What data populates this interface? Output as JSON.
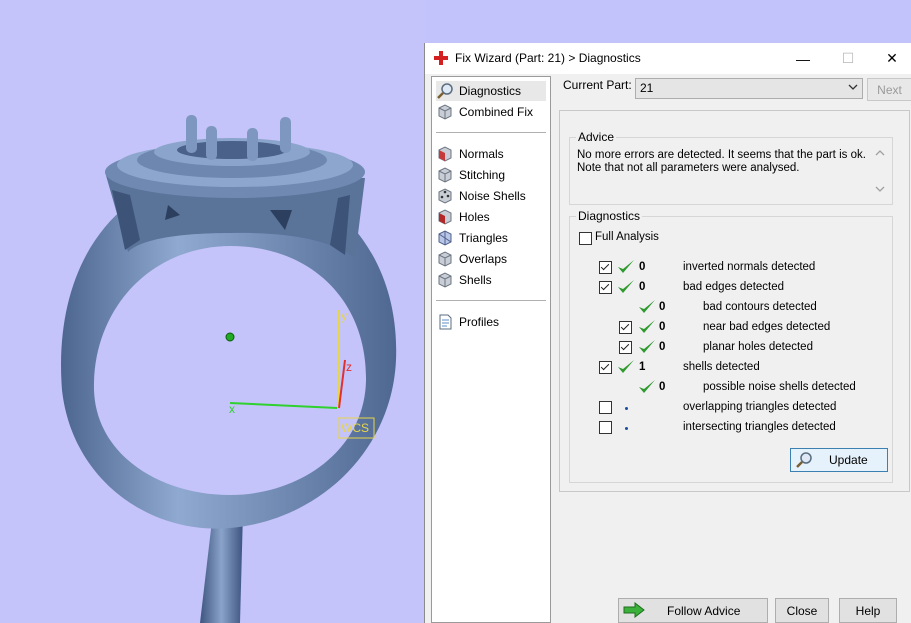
{
  "window": {
    "title": "Fix Wizard (Part: 21) > Diagnostics",
    "minimize_glyph": "—",
    "maximize_glyph": "☐",
    "close_glyph": "✕"
  },
  "nav": {
    "items": [
      {
        "label": "Diagnostics",
        "icon": "magnifier-icon"
      },
      {
        "label": "Combined Fix",
        "icon": "cube-icon"
      },
      {
        "label": "Normals",
        "icon": "cube-red-icon"
      },
      {
        "label": "Stitching",
        "icon": "cube-icon"
      },
      {
        "label": "Noise Shells",
        "icon": "cube-dots-icon"
      },
      {
        "label": "Holes",
        "icon": "cube-red-icon"
      },
      {
        "label": "Triangles",
        "icon": "cube-blue-icon"
      },
      {
        "label": "Overlaps",
        "icon": "cube-icon"
      },
      {
        "label": "Shells",
        "icon": "cube-icon"
      },
      {
        "label": "Profiles",
        "icon": "document-icon"
      }
    ]
  },
  "header": {
    "current_part_label": "Current Part:",
    "current_part_value": "21",
    "next_label": "Next"
  },
  "advice": {
    "group_label": "Advice",
    "line1": "No more errors are detected. It seems that the part is ok.",
    "line2": "Note that not all parameters were analysed."
  },
  "diagnostics": {
    "group_label": "Diagnostics",
    "full_analysis_label": "Full Analysis",
    "full_analysis_checked": false,
    "rows": [
      {
        "checked": true,
        "status": "ok",
        "count": "0",
        "label": "inverted normals detected",
        "indent": 0
      },
      {
        "checked": true,
        "status": "ok",
        "count": "0",
        "label": "bad edges detected",
        "indent": 0
      },
      {
        "checked": null,
        "status": "ok",
        "count": "0",
        "label": "bad contours detected",
        "indent": 2
      },
      {
        "checked": true,
        "status": "ok",
        "count": "0",
        "label": "near bad edges detected",
        "indent": 1
      },
      {
        "checked": true,
        "status": "ok",
        "count": "0",
        "label": "planar holes detected",
        "indent": 1
      },
      {
        "checked": true,
        "status": "ok",
        "count": "1",
        "label": "shells detected",
        "indent": 0
      },
      {
        "checked": null,
        "status": "ok",
        "count": "0",
        "label": "possible noise shells detected",
        "indent": 2
      },
      {
        "checked": false,
        "status": "none",
        "count": "",
        "label": "overlapping triangles detected",
        "indent": 0
      },
      {
        "checked": false,
        "status": "none",
        "count": "",
        "label": "intersecting triangles detected",
        "indent": 0
      }
    ],
    "update_label": "Update"
  },
  "footer": {
    "follow_advice_label": "Follow Advice",
    "close_label": "Close",
    "help_label": "Help"
  },
  "viewport": {
    "axis_x": "x",
    "axis_y": "y",
    "axis_z": "z",
    "wcs_label": "WCS"
  },
  "colors": {
    "viewport_bg": "#c4c3fa",
    "ring": "#7f9ac2",
    "check_green": "#2e9a2e",
    "axis_x": "#2ed12e",
    "axis_y": "#e8d64a",
    "axis_z": "#e03030"
  }
}
